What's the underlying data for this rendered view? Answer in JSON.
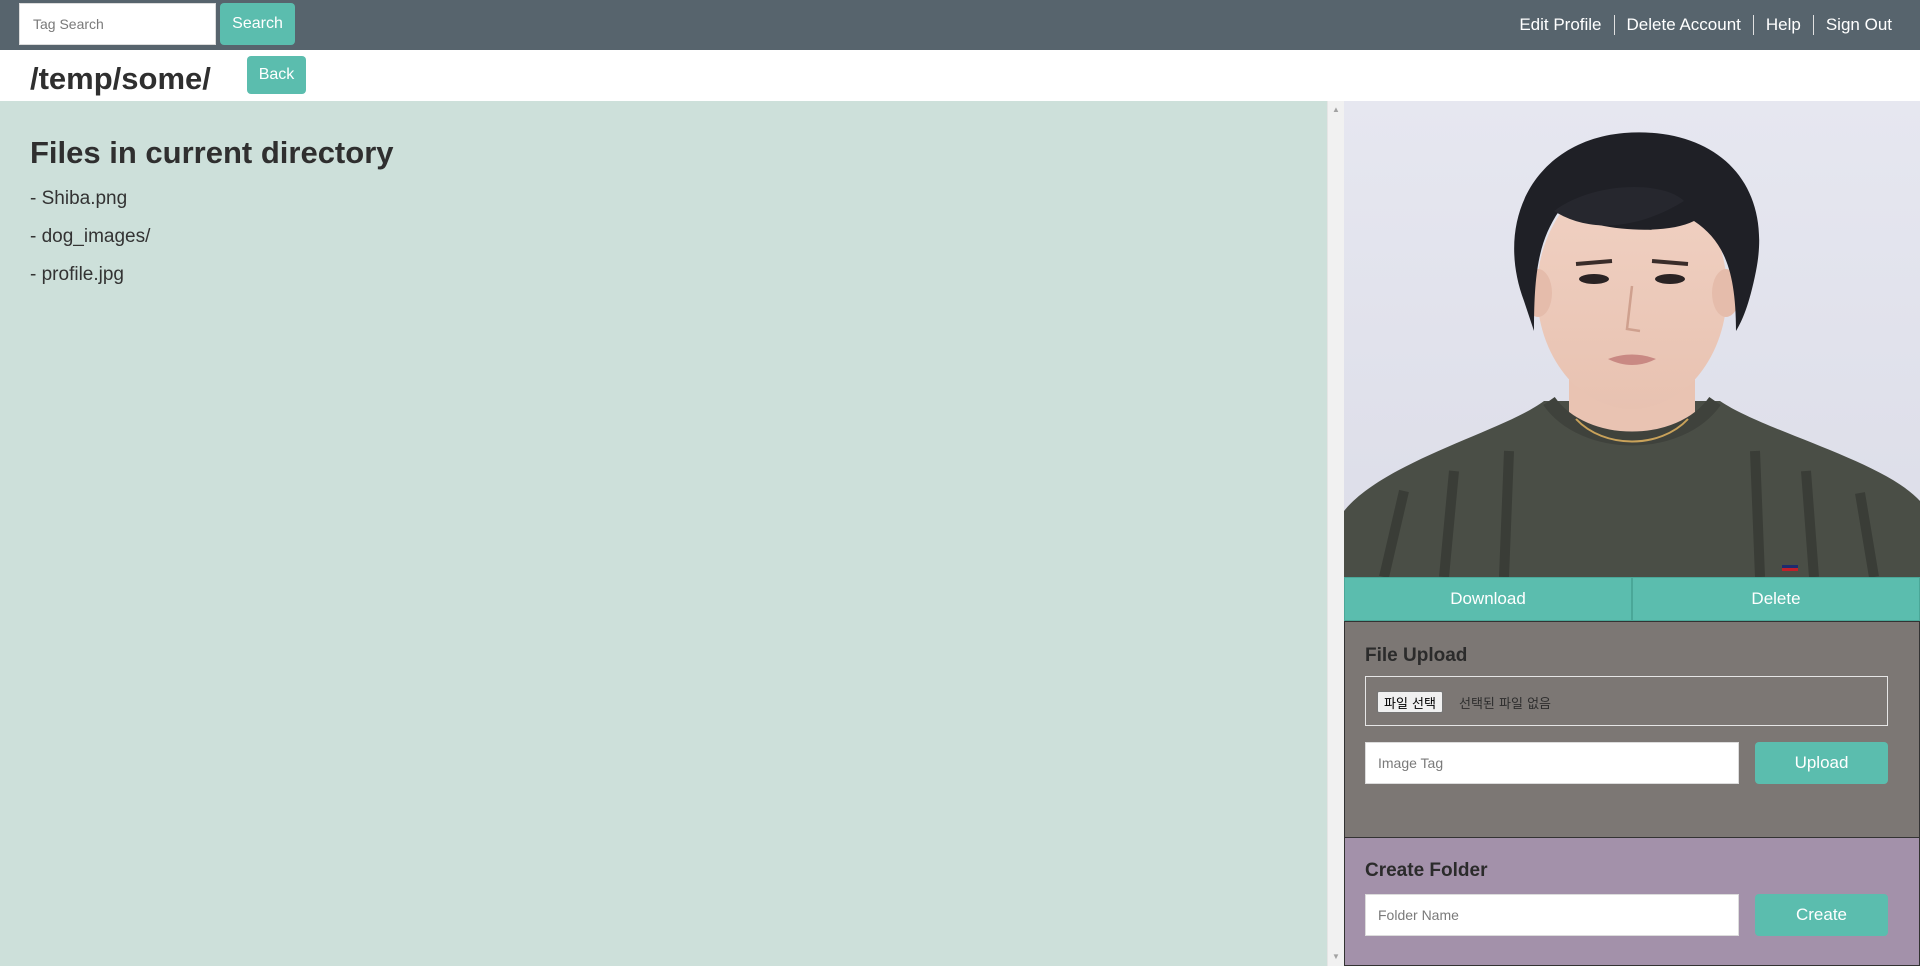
{
  "header": {
    "search": {
      "placeholder": "Tag Search",
      "value": "",
      "button_label": "Search"
    },
    "nav": [
      {
        "label": "Edit Profile"
      },
      {
        "label": "Delete Account"
      },
      {
        "label": "Help"
      },
      {
        "label": "Sign Out"
      }
    ]
  },
  "path_bar": {
    "current_path": "/temp/some/",
    "back_label": "Back"
  },
  "files": {
    "heading": "Files in current directory",
    "items": [
      {
        "label": "- Shiba.png"
      },
      {
        "label": "- dog_images/"
      },
      {
        "label": "- profile.jpg"
      }
    ]
  },
  "preview": {
    "download_label": "Download",
    "delete_label": "Delete"
  },
  "upload": {
    "title": "File Upload",
    "choose_label": "파일 선택",
    "no_file_text": "선택된 파일 없음",
    "tag_placeholder": "Image Tag",
    "tag_value": "",
    "button_label": "Upload"
  },
  "create_folder": {
    "title": "Create Folder",
    "name_placeholder": "Folder Name",
    "name_value": "",
    "button_label": "Create"
  },
  "colors": {
    "topbar": "#57646d",
    "accent": "#5bbdae",
    "files_bg": "#cde0da",
    "upload_bg": "#7c7774",
    "folder_bg": "#a391aa"
  },
  "icons": {
    "scroll_up": "scroll-up-arrow-icon",
    "scroll_down": "scroll-down-arrow-icon"
  }
}
